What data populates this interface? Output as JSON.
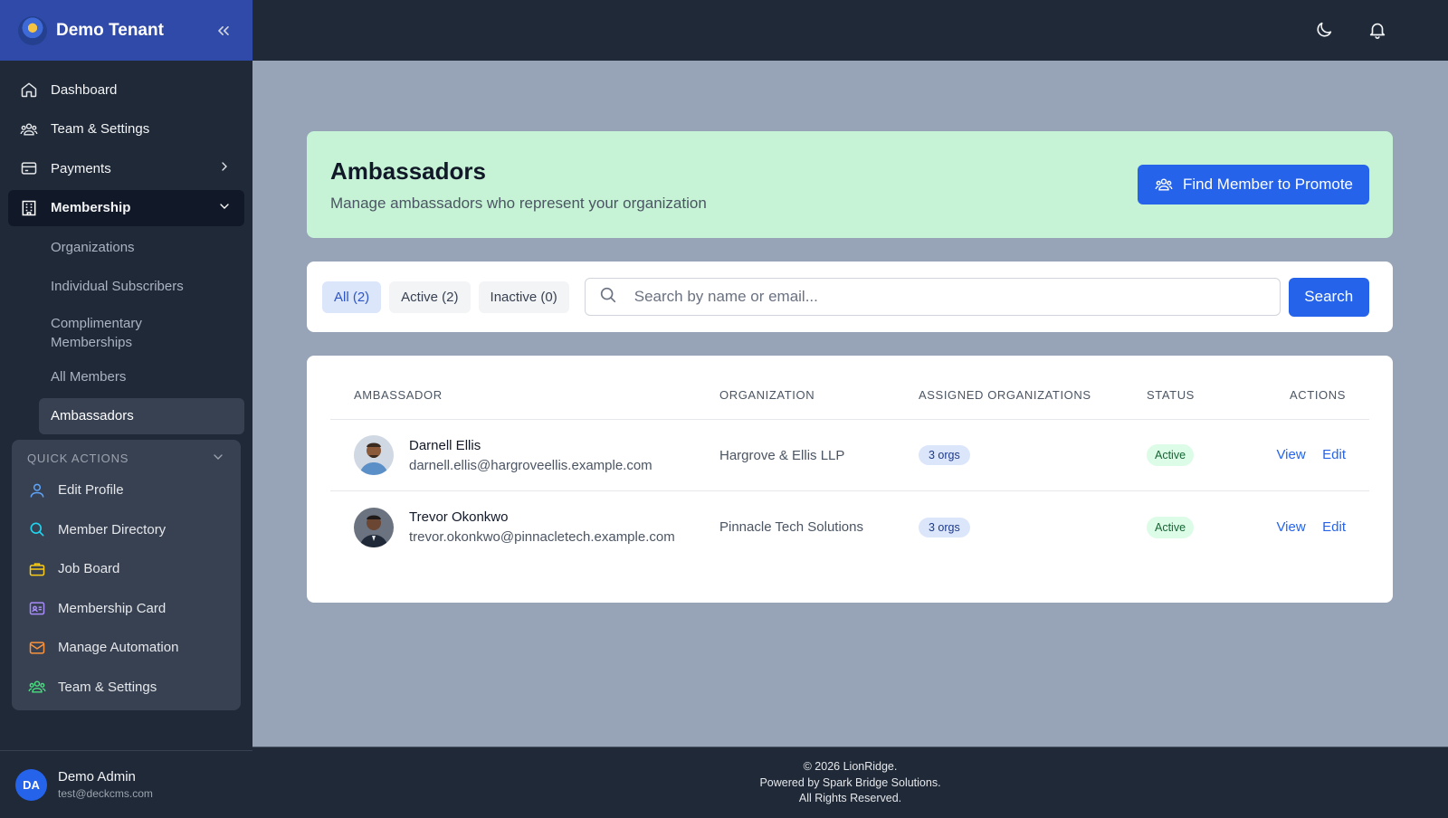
{
  "sidebar": {
    "brand": "Demo Tenant",
    "nav": [
      {
        "label": "Dashboard",
        "icon": "home-icon"
      },
      {
        "label": "Team & Settings",
        "icon": "users-icon"
      },
      {
        "label": "Payments",
        "icon": "credit-card-icon"
      },
      {
        "label": "Membership",
        "icon": "building-icon"
      }
    ],
    "membership_sub": [
      {
        "label": "Organizations"
      },
      {
        "label": "Individual Subscribers"
      },
      {
        "label": "Complimentary Memberships"
      },
      {
        "label": "All Members"
      },
      {
        "label": "Ambassadors"
      }
    ],
    "quick_actions": {
      "title": "QUICK ACTIONS",
      "items": [
        {
          "label": "Edit Profile",
          "icon": "user-icon"
        },
        {
          "label": "Member Directory",
          "icon": "search-icon"
        },
        {
          "label": "Job Board",
          "icon": "briefcase-icon"
        },
        {
          "label": "Membership Card",
          "icon": "id-card-icon"
        },
        {
          "label": "Manage Automation",
          "icon": "mail-icon"
        },
        {
          "label": "Team & Settings",
          "icon": "users-icon"
        }
      ]
    },
    "user": {
      "initials": "DA",
      "name": "Demo Admin",
      "email": "test@deckcms.com"
    }
  },
  "header": {
    "title": "Ambassadors",
    "subtitle": "Manage ambassadors who represent your organization",
    "promote_button": "Find Member to Promote"
  },
  "filters": {
    "tabs": [
      "All (2)",
      "Active (2)",
      "Inactive (0)"
    ],
    "search_placeholder": "Search by name or email...",
    "search_button": "Search"
  },
  "table": {
    "columns": {
      "ambassador": "AMBASSADOR",
      "organization": "ORGANIZATION",
      "assigned": "ASSIGNED ORGANIZATIONS",
      "status": "STATUS",
      "actions": "ACTIONS"
    },
    "rows": [
      {
        "name": "Darnell Ellis",
        "email": "darnell.ellis@hargroveellis.example.com",
        "organization": "Hargrove & Ellis LLP",
        "assigned": "3 orgs",
        "status": "Active",
        "view": "View",
        "edit": "Edit"
      },
      {
        "name": "Trevor Okonkwo",
        "email": "trevor.okonkwo@pinnacletech.example.com",
        "organization": "Pinnacle Tech Solutions",
        "assigned": "3 orgs",
        "status": "Active",
        "view": "View",
        "edit": "Edit"
      }
    ]
  },
  "footer": {
    "line1": "© 2026 LionRidge.",
    "line2": "Powered by Spark Bridge Solutions.",
    "line3": "All Rights Reserved."
  },
  "colors": {
    "accent": "#2563eb",
    "sidebar": "#1f2937",
    "brand_bar": "#2f4aa8",
    "header_card": "#c6f3d5"
  }
}
